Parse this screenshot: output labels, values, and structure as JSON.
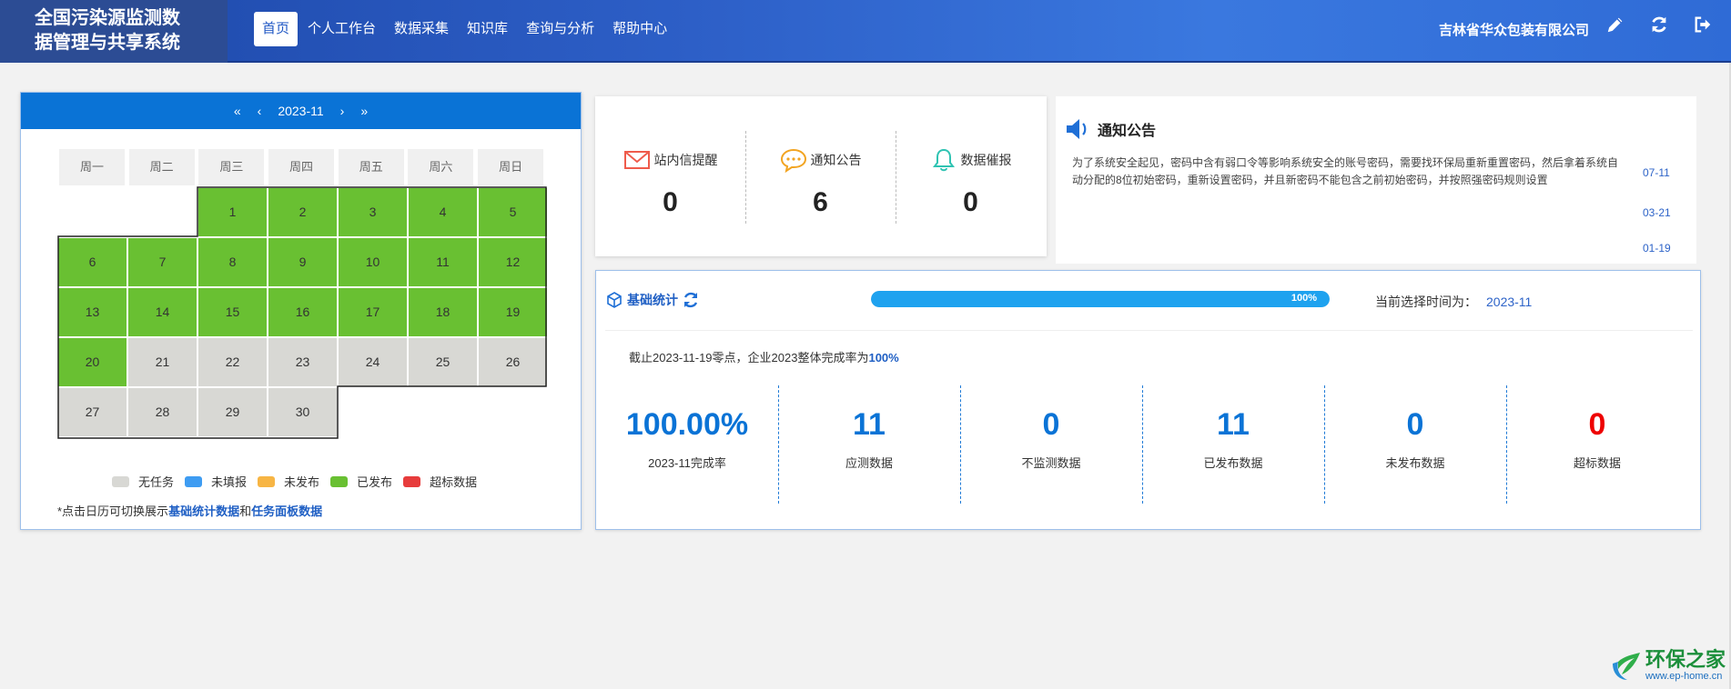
{
  "header": {
    "title_line1": "全国污染源监测数",
    "title_line2": "据管理与共享系统",
    "nav": [
      "首页",
      "个人工作台",
      "数据采集",
      "知识库",
      "查询与分析",
      "帮助中心"
    ],
    "company": "吉林省华众包装有限公司",
    "icons": [
      "pencil-icon",
      "refresh-icon",
      "logout-icon"
    ]
  },
  "calendar": {
    "prev_year": "«",
    "prev_month": "‹",
    "month": "2023-11",
    "next_month": "›",
    "next_year": "»",
    "weekdays": [
      "周一",
      "周二",
      "周三",
      "周四",
      "周五",
      "周六",
      "周日"
    ],
    "days": [
      {
        "day": "1",
        "status": "published"
      },
      {
        "day": "2",
        "status": "published"
      },
      {
        "day": "3",
        "status": "published"
      },
      {
        "day": "4",
        "status": "published"
      },
      {
        "day": "5",
        "status": "published"
      },
      {
        "day": "6",
        "status": "published"
      },
      {
        "day": "7",
        "status": "published"
      },
      {
        "day": "8",
        "status": "published"
      },
      {
        "day": "9",
        "status": "published"
      },
      {
        "day": "10",
        "status": "published"
      },
      {
        "day": "11",
        "status": "published"
      },
      {
        "day": "12",
        "status": "published"
      },
      {
        "day": "13",
        "status": "published"
      },
      {
        "day": "14",
        "status": "published"
      },
      {
        "day": "15",
        "status": "published"
      },
      {
        "day": "16",
        "status": "published"
      },
      {
        "day": "17",
        "status": "published"
      },
      {
        "day": "18",
        "status": "published"
      },
      {
        "day": "19",
        "status": "published"
      },
      {
        "day": "20",
        "status": "published"
      },
      {
        "day": "21",
        "status": "none"
      },
      {
        "day": "22",
        "status": "none"
      },
      {
        "day": "23",
        "status": "none"
      },
      {
        "day": "24",
        "status": "none"
      },
      {
        "day": "25",
        "status": "none"
      },
      {
        "day": "26",
        "status": "none"
      },
      {
        "day": "27",
        "status": "none"
      },
      {
        "day": "28",
        "status": "none"
      },
      {
        "day": "29",
        "status": "none"
      },
      {
        "day": "30",
        "status": "none"
      }
    ],
    "colors": {
      "published": "#69c032",
      "none": "#d8d8d4"
    },
    "legend": [
      {
        "label": "无任务",
        "color": "#d8d8d4"
      },
      {
        "label": "未填报",
        "color": "#3e9cf2"
      },
      {
        "label": "未发布",
        "color": "#f7b544"
      },
      {
        "label": "已发布",
        "color": "#69c032"
      },
      {
        "label": "超标数据",
        "color": "#e73c3c"
      }
    ],
    "note_prefix": "*点击日历可切换展示",
    "note_link1": "基础统计数据",
    "note_and": "和",
    "note_link2": "任务面板数据"
  },
  "messages": [
    {
      "label": "站内信提醒",
      "count": "0",
      "icon": "envelope-icon"
    },
    {
      "label": "通知公告",
      "count": "6",
      "icon": "chat-bubble-icon"
    },
    {
      "label": "数据催报",
      "count": "0",
      "icon": "bell-icon"
    }
  ],
  "notice": {
    "title": "通知公告",
    "text": "为了系统安全起见，密码中含有弱口令等影响系统安全的账号密码，需要找环保局重新重置密码，然后拿着系统自动分配的8位初始密码，重新设置密码，并且新密码不能包含之前初始密码，并按照强密码规则设置",
    "dates": [
      "07-11",
      "03-21",
      "01-19"
    ]
  },
  "stats": {
    "title": "基础统计",
    "progress_value": 100,
    "progress_text": "100%",
    "current_time_label": "当前选择时间为：",
    "current_time_value": "2023-11",
    "summary_prefix": "截止2023-11-19零点，企业2023整体完成率为",
    "summary_pct": "100%",
    "kpis": [
      {
        "value": "100.00%",
        "label": "2023-11完成率",
        "red": false
      },
      {
        "value": "11",
        "label": "应测数据",
        "red": false
      },
      {
        "value": "0",
        "label": "不监测数据",
        "red": false
      },
      {
        "value": "11",
        "label": "已发布数据",
        "red": false
      },
      {
        "value": "0",
        "label": "未发布数据",
        "red": false
      },
      {
        "value": "0",
        "label": "超标数据",
        "red": true
      }
    ]
  },
  "watermark": {
    "main": "环保之家",
    "sub": "www.ep-home.cn"
  }
}
